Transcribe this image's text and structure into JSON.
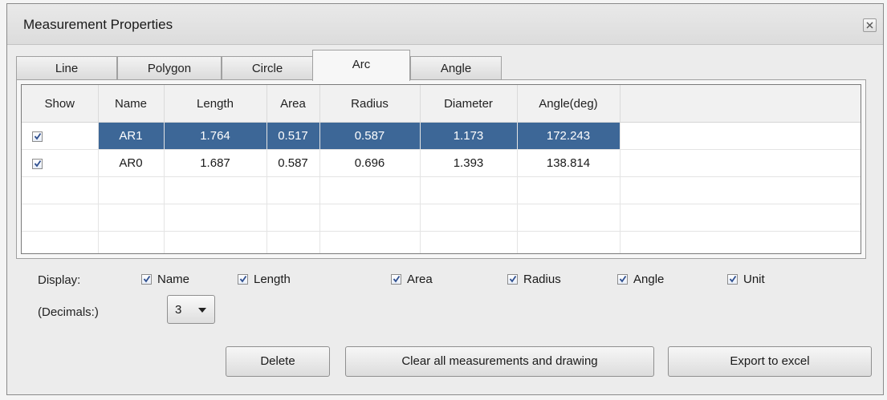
{
  "window": {
    "title": "Measurement Properties"
  },
  "tabs": [
    {
      "label": "Line",
      "active": false
    },
    {
      "label": "Polygon",
      "active": false
    },
    {
      "label": "Circle",
      "active": false
    },
    {
      "label": "Arc",
      "active": true
    },
    {
      "label": "Angle",
      "active": false
    }
  ],
  "table": {
    "columns": [
      "Show",
      "Name",
      "Length",
      "Area",
      "Radius",
      "Diameter",
      "Angle(deg)"
    ],
    "rows": [
      {
        "show": true,
        "selected": true,
        "cells": [
          "AR1",
          "1.764",
          "0.517",
          "0.587",
          "1.173",
          "172.243"
        ]
      },
      {
        "show": true,
        "selected": false,
        "cells": [
          "AR0",
          "1.687",
          "0.587",
          "0.696",
          "1.393",
          "138.814"
        ]
      }
    ]
  },
  "display": {
    "label": "Display:",
    "options": [
      {
        "label": "Name",
        "checked": true
      },
      {
        "label": "Length",
        "checked": true
      },
      {
        "label": "Area",
        "checked": true
      },
      {
        "label": "Radius",
        "checked": true
      },
      {
        "label": "Angle",
        "checked": true
      },
      {
        "label": "Unit",
        "checked": true
      }
    ]
  },
  "decimals": {
    "label": "(Decimals:)",
    "value": "3"
  },
  "buttons": {
    "delete": "Delete",
    "clear_all": "Clear all measurements and drawing",
    "export": "Export to excel"
  },
  "colors": {
    "selection": "#3d6797",
    "check": "#2f4f8f"
  }
}
